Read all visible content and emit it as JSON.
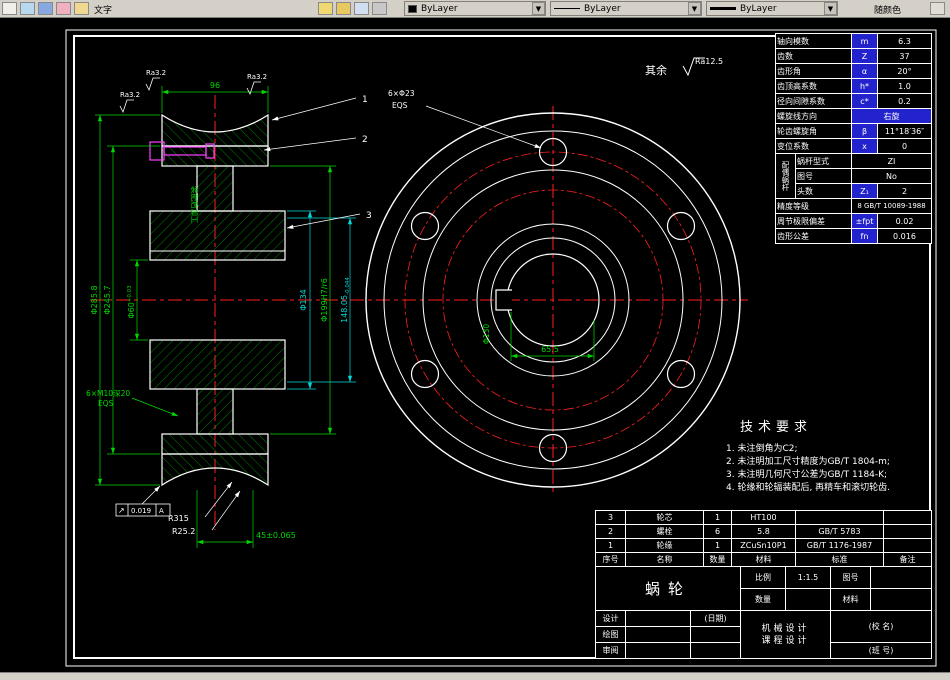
{
  "toolbar": {
    "text_tool": "文字",
    "color_value": "ByLayer",
    "linetype_value": "ByLayer",
    "lineweight_value": "ByLayer",
    "plot_style": "随颜色"
  },
  "param_table": {
    "rows": [
      {
        "name": "轴向模数",
        "sym": "m",
        "val": "6.3"
      },
      {
        "name": "齿数",
        "sym": "Z",
        "val": "37"
      },
      {
        "name": "齿形角",
        "sym": "α",
        "val": "20°"
      },
      {
        "name": "齿顶高系数",
        "sym": "h*",
        "val": "1.0"
      },
      {
        "name": "径向间隙系数",
        "sym": "c*",
        "val": "0.2"
      },
      {
        "name": "螺旋线方向",
        "sym": "",
        "val": "右旋"
      },
      {
        "name": "轮齿螺旋角",
        "sym": "β",
        "val": "11°18′36″"
      },
      {
        "name": "变位系数",
        "sym": "x",
        "val": "0"
      }
    ],
    "mate": {
      "group_label": "配偶蜗杆",
      "r1_name": "蜗杆型式",
      "r1_val": "ZI",
      "r2_name": "图号",
      "r2_val": "No",
      "r3_name": "头数",
      "r3_sym": "Z₁",
      "r3_val": "2"
    },
    "tail": [
      {
        "name": "精度等级",
        "val": "8 GB/T 10089-1988"
      },
      {
        "name": "周节极限偏差",
        "sym": "±fpt",
        "val": "0.02"
      },
      {
        "name": "齿形公差",
        "sym": "fn",
        "val": "0.016"
      }
    ]
  },
  "tech_req": {
    "title": "技术要求",
    "items": [
      "1. 未注倒角为C2;",
      "2. 未注明加工尺寸精度为GB/T 1804-m;",
      "3. 未注明几何尺寸公差为GB/T 1184-K;",
      "4. 轮缘和轮辐装配后, 再精车和滚切轮齿."
    ]
  },
  "parts_list": {
    "headers": {
      "no": "序号",
      "name": "名称",
      "qty": "数量",
      "mat": "材料",
      "std": "标准",
      "rem": "备注"
    },
    "rows": [
      {
        "no": "3",
        "name": "轮芯",
        "qty": "1",
        "mat": "HT100",
        "std": "",
        "rem": ""
      },
      {
        "no": "2",
        "name": "螺栓",
        "qty": "6",
        "mat": "5.8",
        "std": "GB/T 5783",
        "rem": ""
      },
      {
        "no": "1",
        "name": "轮缘",
        "qty": "1",
        "mat": "ZCuSn10P1",
        "std": "GB/T 1176-1987",
        "rem": ""
      }
    ]
  },
  "title_block": {
    "part_name": "蜗轮",
    "scale_label": "比例",
    "scale": "1:1.5",
    "qty_label": "数量",
    "qty": "",
    "fig_label": "图号",
    "mat_label": "材料",
    "design": "设计",
    "date": "(日期)",
    "draw": "绘图",
    "review": "审阅",
    "course1": "机械设计",
    "course2": "课程设计",
    "school": "(校 名)",
    "class_no": "(班 号)"
  },
  "annotations": {
    "surplus": "其余",
    "ra_default": "Ra12.5",
    "ra": "Ra3.2",
    "w96": "96",
    "d285": "Φ285.8",
    "d245": "Φ245.7",
    "d60": "Φ60",
    "d60_tol": "+0.03",
    "d134": "Φ134",
    "d199": "Φ199H7/r6",
    "l148": "148.05",
    "l148_tol": "-0.044",
    "w45": "45±0.065",
    "r315": "R315",
    "r252": "R25.2",
    "m10": "6×M10深20",
    "eqs": "EQS",
    "d23": "6×Φ23",
    "k655": "65.5",
    "d130": "Φ130",
    "gdt": "0.019",
    "datum": "A",
    "assembly_note": "装配后加工",
    "b1": "1",
    "b2": "2",
    "b3": "3"
  }
}
